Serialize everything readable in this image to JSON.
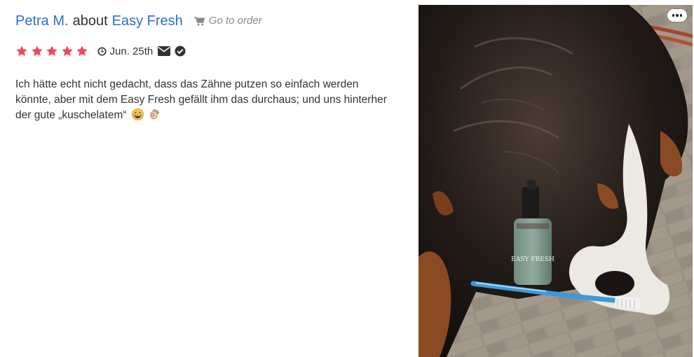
{
  "review": {
    "author": "Petra M.",
    "about_word": "about",
    "product": "Easy Fresh",
    "order_link": "Go to order",
    "rating": 5,
    "rating_max": 5,
    "date": "Jun. 25th",
    "text": "Ich hätte echt nicht gedacht, dass das Zähne putzen so einfach werden könnte, aber mit dem Easy  Fresh gefällt ihm das durchaus; und uns hinterher der gute „kuschelatem“",
    "emojis": [
      "laughing-emoji",
      "ok-hand-emoji"
    ]
  },
  "photo": {
    "bottle_label": "EASY FRESH"
  },
  "colors": {
    "star": "#f04a5a",
    "link": "#2a6fdb",
    "text": "#333333",
    "muted": "#888888"
  },
  "icons": [
    "cart-icon",
    "clock-icon",
    "envelope-icon",
    "verified-check-icon",
    "more-options-icon",
    "star-icon"
  ]
}
